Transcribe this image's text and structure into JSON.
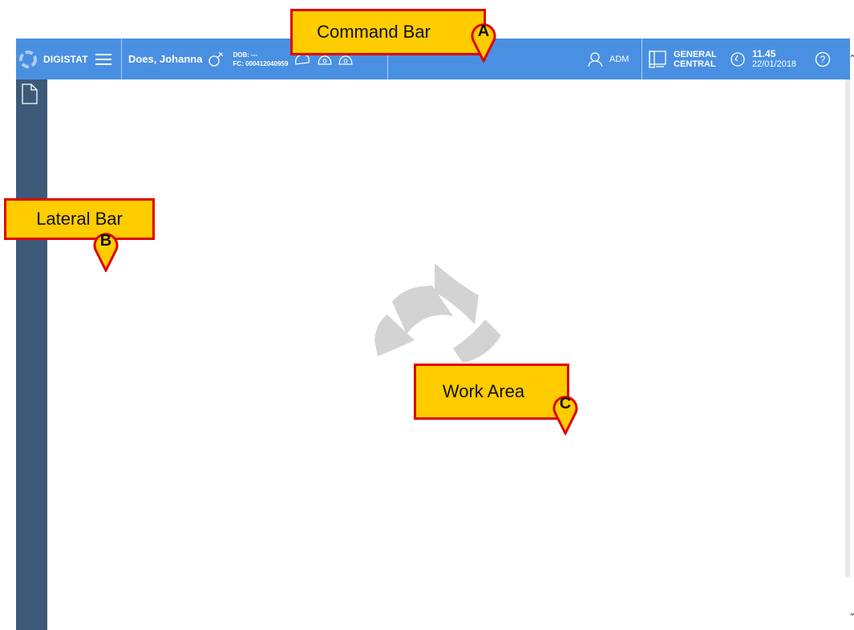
{
  "command_bar": {
    "brand": "DIGISTAT",
    "patient": {
      "name": "Does, Johanna",
      "dob": "DOB: ---",
      "fc": "FC: 000412040959"
    },
    "user": "ADM",
    "location": {
      "line1": "GENERAL",
      "line2": "CENTRAL"
    },
    "clock": {
      "time": "11.45",
      "date": "22/01/2018"
    },
    "help_symbol": "?"
  },
  "callouts": {
    "command_bar": {
      "label": "Command Bar",
      "letter": "A"
    },
    "lateral_bar": {
      "label": "Lateral Bar",
      "letter": "B"
    },
    "work_area": {
      "label": "Work Area",
      "letter": "C"
    }
  },
  "colors": {
    "command_bar": "#4a90e2",
    "lateral_bar": "#3c5a78",
    "callout_fill": "#ffcc00",
    "callout_border": "#e00000"
  },
  "icons": [
    "digistat-logo-icon",
    "menu-icon",
    "male-gender-icon",
    "patient-alarm-icons",
    "user-icon",
    "workstation-icon",
    "clock-icon",
    "help-icon",
    "new-document-icon",
    "digistat-watermark-icon"
  ]
}
